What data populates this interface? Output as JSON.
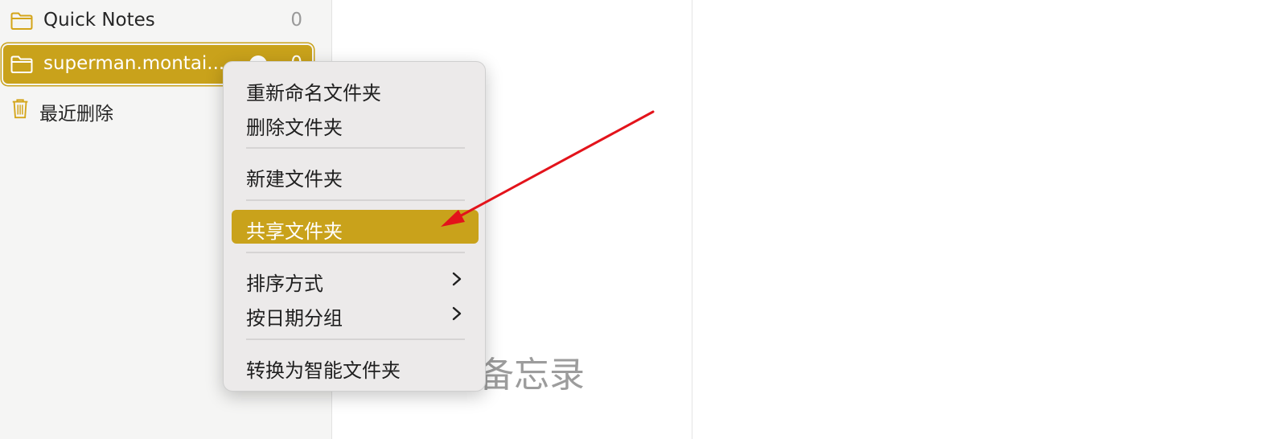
{
  "sidebar": {
    "folders": [
      {
        "name": "Quick Notes",
        "count": "0"
      },
      {
        "name": "superman.montai...",
        "count": "0"
      }
    ],
    "trash": {
      "name": "最近删除"
    }
  },
  "note_list": {
    "empty_text": "备忘录"
  },
  "context_menu": {
    "items": [
      {
        "label": "重新命名文件夹"
      },
      {
        "label": "删除文件夹"
      },
      {
        "label": "新建文件夹"
      },
      {
        "label": "共享文件夹"
      },
      {
        "label": "排序方式"
      },
      {
        "label": "按日期分组"
      },
      {
        "label": "转换为智能文件夹"
      }
    ]
  },
  "colors": {
    "accent": "#c9a21b",
    "arrow": "#e3131b"
  },
  "icons": {
    "folder": "folder-icon",
    "trash": "trash-icon",
    "submenu": "chevron-right-icon"
  }
}
